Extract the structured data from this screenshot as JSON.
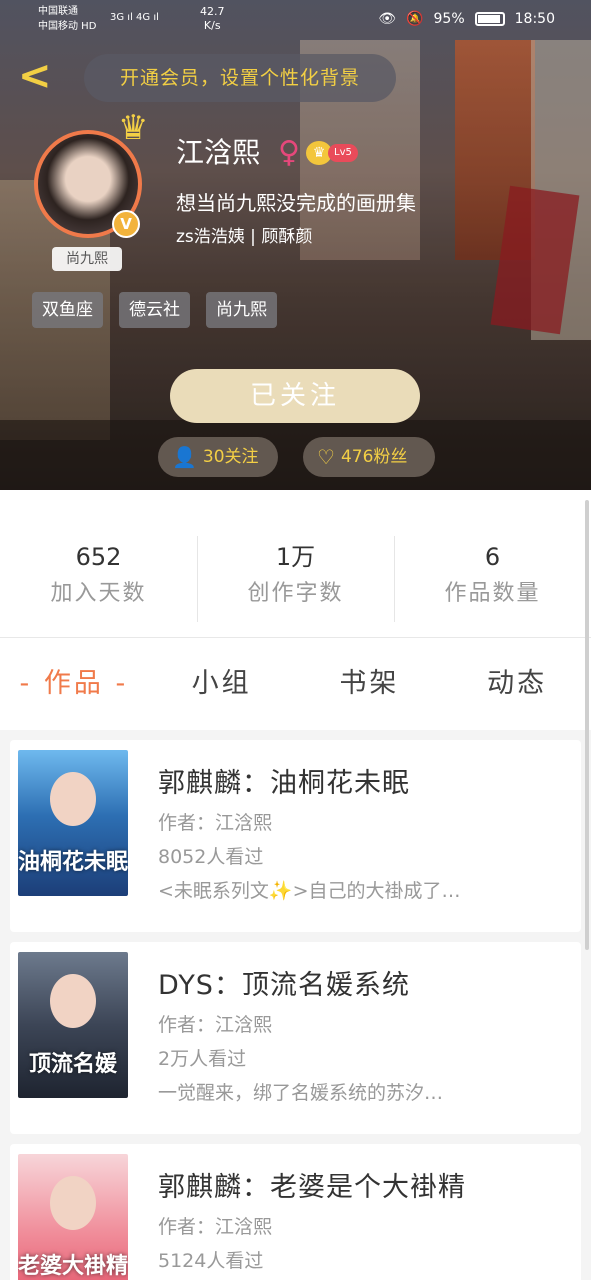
{
  "status_bar": {
    "carrier1": "中国联通",
    "carrier2": "中国移动 HD",
    "signal": "3G ıl 4G ıl",
    "speed": "42.7\nK/s",
    "battery": "95%",
    "time": "18:50"
  },
  "header": {
    "back_icon": "back-chevron-icon",
    "vip_banner": "开通会员，设置个性化背景",
    "username": "江浛熙",
    "gender_symbol": "♀",
    "level": "Lv5",
    "bio_line1": "想当尚九熙没完成的画册集",
    "bio_line2": "zs浩浩姨 | 顾酥颜",
    "avatar_tag": "尚九熙",
    "v_badge": "V",
    "tags": [
      "双鱼座",
      "德云社",
      "尚九熙"
    ],
    "follow_button": "已关注",
    "following": "30关注",
    "fans": "476粉丝"
  },
  "stats": [
    {
      "value": "652",
      "label": "加入天数"
    },
    {
      "value": "1万",
      "label": "创作字数"
    },
    {
      "value": "6",
      "label": "作品数量"
    }
  ],
  "tabs": [
    {
      "label": "- 作品 -",
      "active": true
    },
    {
      "label": "小组",
      "active": false
    },
    {
      "label": "书架",
      "active": false
    },
    {
      "label": "动态",
      "active": false
    }
  ],
  "works": [
    {
      "title": "郭麒麟：油桐花未眠",
      "author": "作者：江浛熙",
      "views": "8052人看过",
      "summary": "<未眠系列文✨>自己的大褂成了…",
      "cover_text": "油桐花未眠"
    },
    {
      "title": "DYS：顶流名媛系统",
      "author": "作者：江浛熙",
      "views": "2万人看过",
      "summary": "一觉醒来，绑了名媛系统的苏汐…",
      "cover_text": "顶流名媛"
    },
    {
      "title": "郭麒麟：老婆是个大褂精",
      "author": "作者：江浛熙",
      "views": "5124人看过",
      "summary": "",
      "cover_text": "老婆大褂精"
    }
  ]
}
